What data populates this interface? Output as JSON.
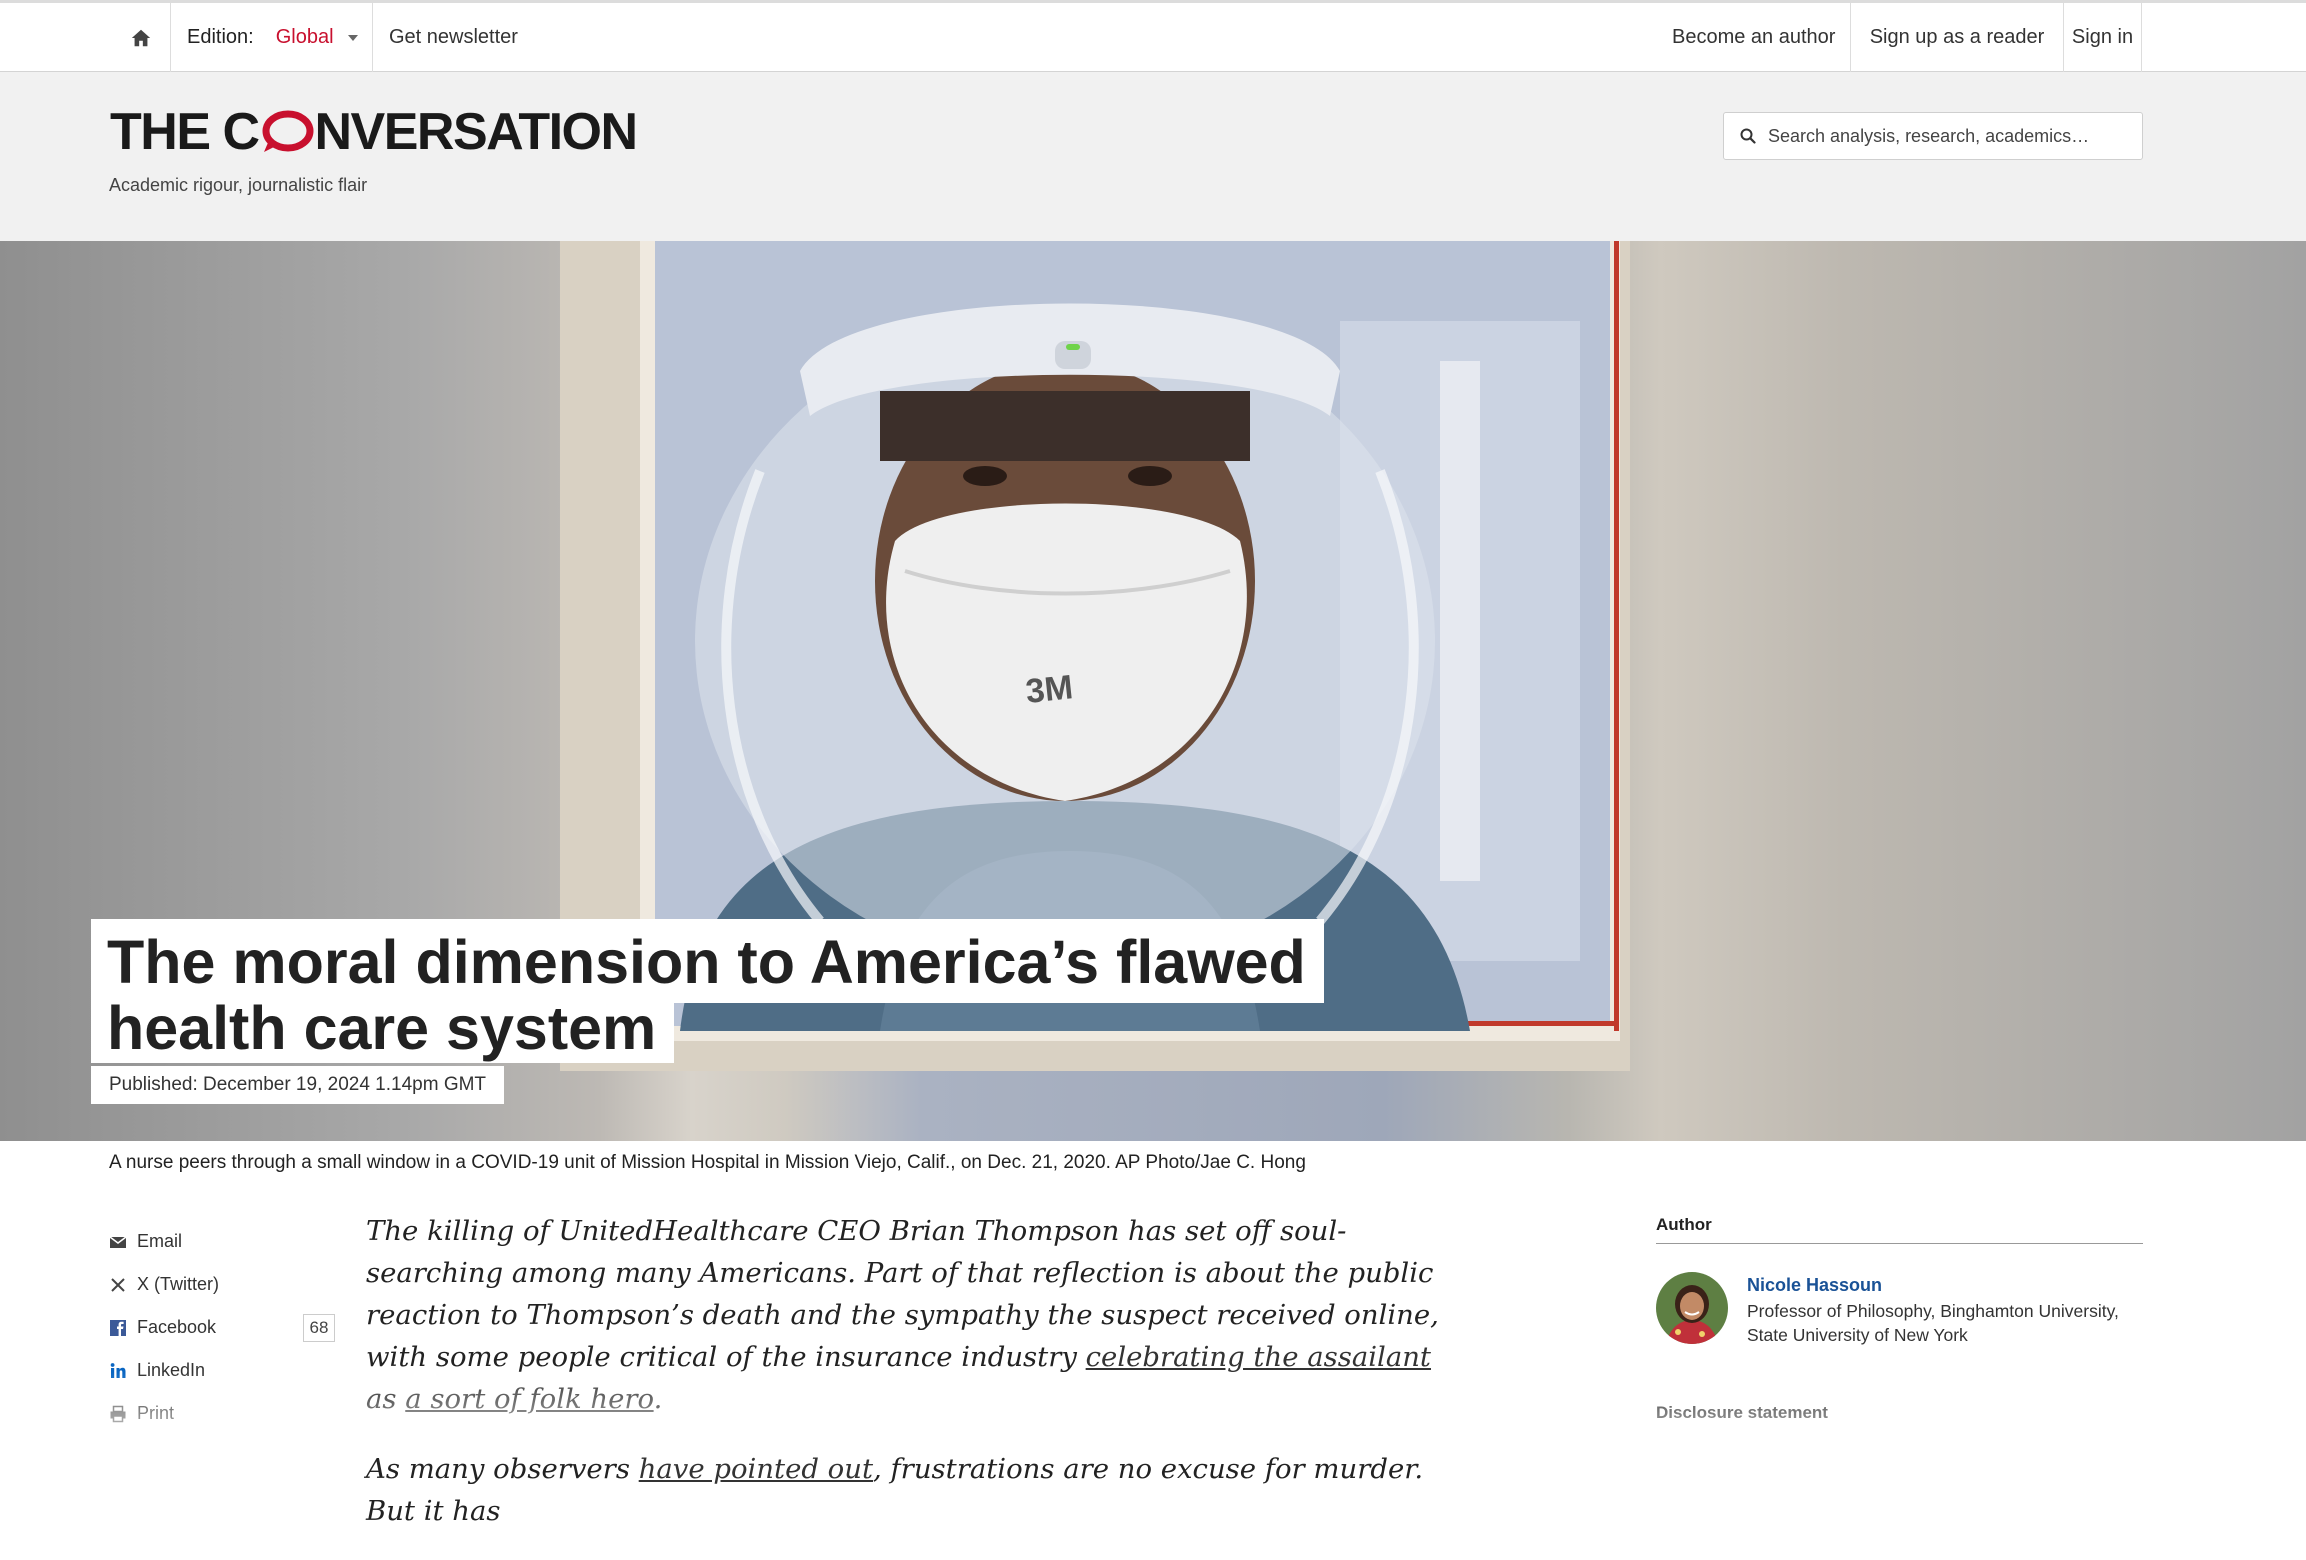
{
  "topbar": {
    "edition_label": "Edition:",
    "edition_value": "Global",
    "newsletter": "Get newsletter",
    "become_author": "Become an author",
    "sign_up_reader": "Sign up as a reader",
    "sign_in": "Sign in"
  },
  "brand": {
    "logo_pre": "THE C",
    "logo_post": "NVERSATION",
    "tagline": "Academic rigour, journalistic flair",
    "accent": "#c8102e"
  },
  "search": {
    "placeholder": "Search analysis, research, academics…"
  },
  "hero": {
    "headline_line1": "The moral dimension to America’s flawed",
    "headline_line2": "health care system",
    "published": "Published: December 19, 2024 1.14pm GMT",
    "mask_brand": "3M",
    "caption": "A nurse peers through a small window in a COVID-19 unit of Mission Hospital in Mission Viejo, Calif., on Dec. 21, 2020. AP Photo/Jae C. Hong"
  },
  "share": {
    "email": "Email",
    "twitter": "X (Twitter)",
    "facebook": "Facebook",
    "facebook_count": "68",
    "linkedin": "LinkedIn",
    "print": "Print"
  },
  "article": {
    "p1_a": "The killing of UnitedHealthcare CEO Brian Thompson has set off soul-searching among many Americans. Part of that reflection is about the public reaction to Thompson’s death and the sympathy the suspect received online, with some people critical of the insurance industry ",
    "p1_link1": "celebrating the assailant",
    "p1_b": " as ",
    "p1_link2": "a sort of folk hero",
    "p1_c": ".",
    "p2_a": "As many observers ",
    "p2_link1": "have pointed out",
    "p2_b": ", frustrations are no excuse for murder. But it has"
  },
  "sidebar": {
    "author_heading": "Author",
    "author_name": "Nicole Hassoun",
    "author_role": "Professor of Philosophy, Binghamton University, State University of New York",
    "disclosure_heading": "Disclosure statement"
  }
}
